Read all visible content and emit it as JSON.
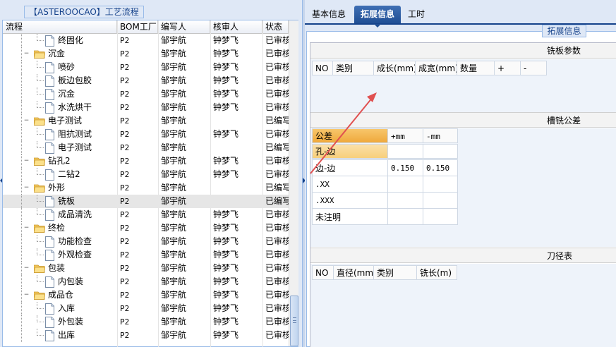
{
  "left_panel": {
    "title": "【ASTEROOCAO】工艺流程",
    "columns": [
      "流程",
      "BOM工厂",
      "编写人",
      "核审人",
      "状态"
    ],
    "rows": [
      {
        "level": 2,
        "type": "doc",
        "name": "终固化",
        "bom": "P2",
        "writer": "邹宇航",
        "reviewer": "钟梦飞",
        "status": "已审核"
      },
      {
        "level": 1,
        "type": "folder",
        "name": "沉金",
        "bom": "P2",
        "writer": "邹宇航",
        "reviewer": "钟梦飞",
        "status": "已审核"
      },
      {
        "level": 2,
        "type": "doc",
        "name": "喷砂",
        "bom": "P2",
        "writer": "邹宇航",
        "reviewer": "钟梦飞",
        "status": "已审核"
      },
      {
        "level": 2,
        "type": "doc",
        "name": "板边包胶",
        "bom": "P2",
        "writer": "邹宇航",
        "reviewer": "钟梦飞",
        "status": "已审核"
      },
      {
        "level": 2,
        "type": "doc",
        "name": "沉金",
        "bom": "P2",
        "writer": "邹宇航",
        "reviewer": "钟梦飞",
        "status": "已审核"
      },
      {
        "level": 2,
        "type": "doc",
        "name": "水洗烘干",
        "bom": "P2",
        "writer": "邹宇航",
        "reviewer": "钟梦飞",
        "status": "已审核"
      },
      {
        "level": 1,
        "type": "folder",
        "name": "电子测试",
        "bom": "P2",
        "writer": "邹宇航",
        "reviewer": "",
        "status": "已编写"
      },
      {
        "level": 2,
        "type": "doc",
        "name": "阻抗测试",
        "bom": "P2",
        "writer": "邹宇航",
        "reviewer": "钟梦飞",
        "status": "已审核"
      },
      {
        "level": 2,
        "type": "doc",
        "name": "电子测试",
        "bom": "P2",
        "writer": "邹宇航",
        "reviewer": "",
        "status": "已编写"
      },
      {
        "level": 1,
        "type": "folder",
        "name": "钻孔2",
        "bom": "P2",
        "writer": "邹宇航",
        "reviewer": "钟梦飞",
        "status": "已审核"
      },
      {
        "level": 2,
        "type": "doc",
        "name": "二钻2",
        "bom": "P2",
        "writer": "邹宇航",
        "reviewer": "钟梦飞",
        "status": "已审核"
      },
      {
        "level": 1,
        "type": "folder",
        "name": "外形",
        "bom": "P2",
        "writer": "邹宇航",
        "reviewer": "",
        "status": "已编写"
      },
      {
        "level": 2,
        "type": "doc",
        "name": "铣板",
        "bom": "P2",
        "writer": "邹宇航",
        "reviewer": "",
        "status": "已编写",
        "selected": true
      },
      {
        "level": 2,
        "type": "doc",
        "name": "成品清洗",
        "bom": "P2",
        "writer": "邹宇航",
        "reviewer": "钟梦飞",
        "status": "已审核"
      },
      {
        "level": 1,
        "type": "folder",
        "name": "终检",
        "bom": "P2",
        "writer": "邹宇航",
        "reviewer": "钟梦飞",
        "status": "已审核"
      },
      {
        "level": 2,
        "type": "doc",
        "name": "功能检查",
        "bom": "P2",
        "writer": "邹宇航",
        "reviewer": "钟梦飞",
        "status": "已审核"
      },
      {
        "level": 2,
        "type": "doc",
        "name": "外观检查",
        "bom": "P2",
        "writer": "邹宇航",
        "reviewer": "钟梦飞",
        "status": "已审核"
      },
      {
        "level": 1,
        "type": "folder",
        "name": "包装",
        "bom": "P2",
        "writer": "邹宇航",
        "reviewer": "钟梦飞",
        "status": "已审核"
      },
      {
        "level": 2,
        "type": "doc",
        "name": "内包装",
        "bom": "P2",
        "writer": "邹宇航",
        "reviewer": "钟梦飞",
        "status": "已审核"
      },
      {
        "level": 1,
        "type": "folder",
        "name": "成品仓",
        "bom": "P2",
        "writer": "邹宇航",
        "reviewer": "钟梦飞",
        "status": "已审核"
      },
      {
        "level": 2,
        "type": "doc",
        "name": "入库",
        "bom": "P2",
        "writer": "邹宇航",
        "reviewer": "钟梦飞",
        "status": "已审核"
      },
      {
        "level": 2,
        "type": "doc",
        "name": "外包装",
        "bom": "P2",
        "writer": "邹宇航",
        "reviewer": "钟梦飞",
        "status": "已审核"
      },
      {
        "level": 2,
        "type": "doc",
        "name": "出库",
        "bom": "P2",
        "writer": "邹宇航",
        "reviewer": "钟梦飞",
        "status": "已审核"
      }
    ]
  },
  "tabs": [
    {
      "label": "基本信息",
      "active": false
    },
    {
      "label": "拓展信息",
      "active": true
    },
    {
      "label": "工时",
      "active": false
    }
  ],
  "ext": {
    "legend": "拓展信息",
    "mill_params": {
      "title": "铣板参数",
      "columns": [
        "NO",
        "类别",
        "成长(mm)",
        "成宽(mm)",
        "数量",
        "+",
        "-"
      ]
    },
    "tolerance": {
      "title": "槽铣公差",
      "columns": [
        "公差",
        "+mm",
        "-mm"
      ],
      "rows": [
        {
          "label": "孔-边",
          "plus": "",
          "minus": ""
        },
        {
          "label": "边-边",
          "plus": "0.150",
          "minus": "0.150"
        },
        {
          "label": ".XX",
          "plus": "",
          "minus": ""
        },
        {
          "label": ".XXX",
          "plus": "",
          "minus": ""
        },
        {
          "label": "未注明",
          "plus": "",
          "minus": ""
        }
      ]
    },
    "tool_table": {
      "title": "刀径表",
      "columns": [
        "NO",
        "直径(mm)",
        "类别",
        "铣长(m)"
      ]
    }
  },
  "colors": {
    "accent": "#15428b",
    "tab_active": "#1f4e94",
    "highlight": "#f7c66b",
    "annotation_arrow": "#e05050"
  }
}
